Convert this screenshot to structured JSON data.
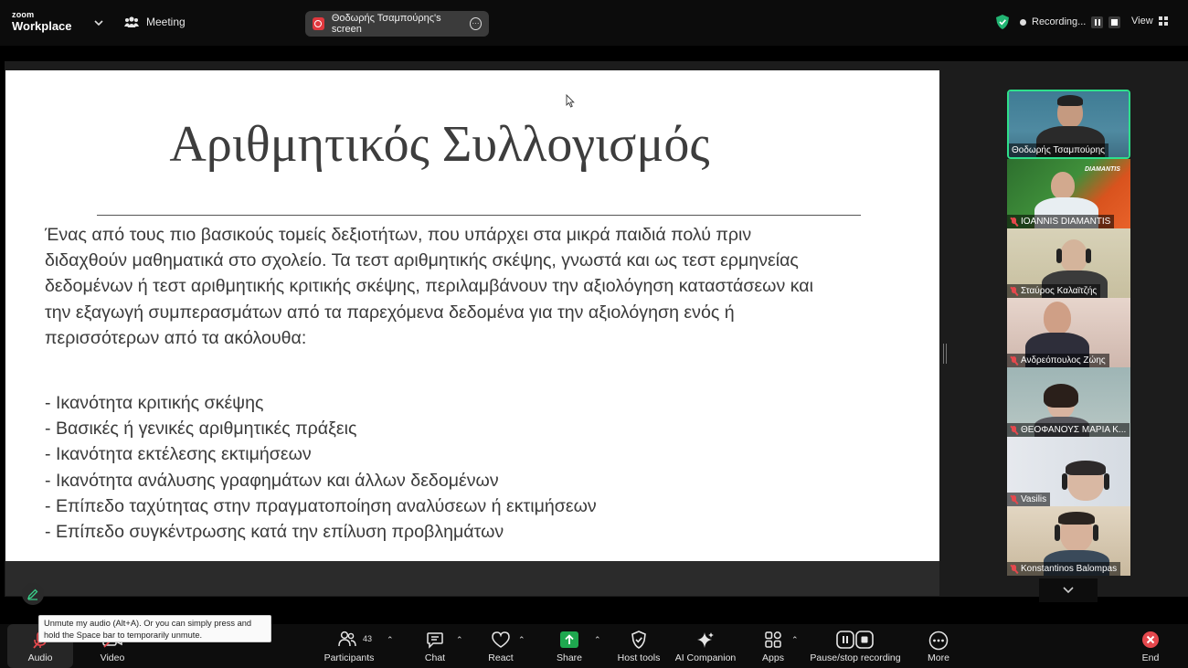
{
  "topbar": {
    "logo_small": "zoom",
    "logo_big": "Workplace",
    "meeting_label": "Meeting",
    "screen_share_label": "Θοδωρής Τσαμπούρης's screen",
    "recording_label": "Recording...",
    "view_label": "View"
  },
  "slide": {
    "title": "Αριθμητικός Συλλογισμός",
    "body_lines": [
      "Ένας από τους πιο βασικούς τομείς δεξιοτήτων, που υπάρχει στα μικρά παιδιά πολύ πριν",
      "διδαχθούν μαθηματικά στο σχολείο. Τα τεστ αριθμητικής σκέψης, γνωστά και ως τεστ ερμηνείας",
      "δεδομένων ή τεστ αριθμητικής κριτικής σκέψης, περιλαμβάνουν την αξιολόγηση καταστάσεων και",
      "την εξαγωγή συμπερασμάτων από τα παρεχόμενα δεδομένα για την αξιολόγηση ενός ή",
      "περισσότερων από τα ακόλουθα:"
    ],
    "list_items": [
      "- Ικανότητα κριτικής σκέψης",
      "- Βασικές ή γενικές αριθμητικές πράξεις",
      "- Ικανότητα εκτέλεσης εκτιμήσεων",
      "- Ικανότητα ανάλυσης γραφημάτων και άλλων δεδομένων",
      "- Επίπεδο ταχύτητας στην πραγματοποίηση αναλύσεων ή εκτιμήσεων",
      "- Επίπεδο συγκέντρωσης κατά την επίλυση προβλημάτων"
    ]
  },
  "participants": [
    {
      "name": "Θοδωρής Τσαμπούρης",
      "muted": false
    },
    {
      "name": "IOANNIS DIAMANTIS",
      "muted": true
    },
    {
      "name": "Σταύρος Καλαϊτζής",
      "muted": true
    },
    {
      "name": "Ανδρεόπουλος Ζώης",
      "muted": true
    },
    {
      "name": "ΘΕΟΦΑΝΟΥΣ ΜΑΡΙΑ Κ...",
      "muted": true
    },
    {
      "name": "Vasilis",
      "muted": true
    },
    {
      "name": "Konstantinos Balompas",
      "muted": true
    }
  ],
  "tile_logo_text": "DIAMANTIS",
  "toolbar": {
    "audio": "Audio",
    "video": "Video",
    "participants": "Participants",
    "participants_count": "43",
    "chat": "Chat",
    "react": "React",
    "share": "Share",
    "host_tools": "Host tools",
    "ai_companion": "AI Companion",
    "apps": "Apps",
    "pause_recording": "Pause/stop recording",
    "more": "More",
    "end": "End"
  },
  "tooltip": "Unmute my audio (Alt+A). Or you can simply press and hold the Space bar to temporarily unmute."
}
